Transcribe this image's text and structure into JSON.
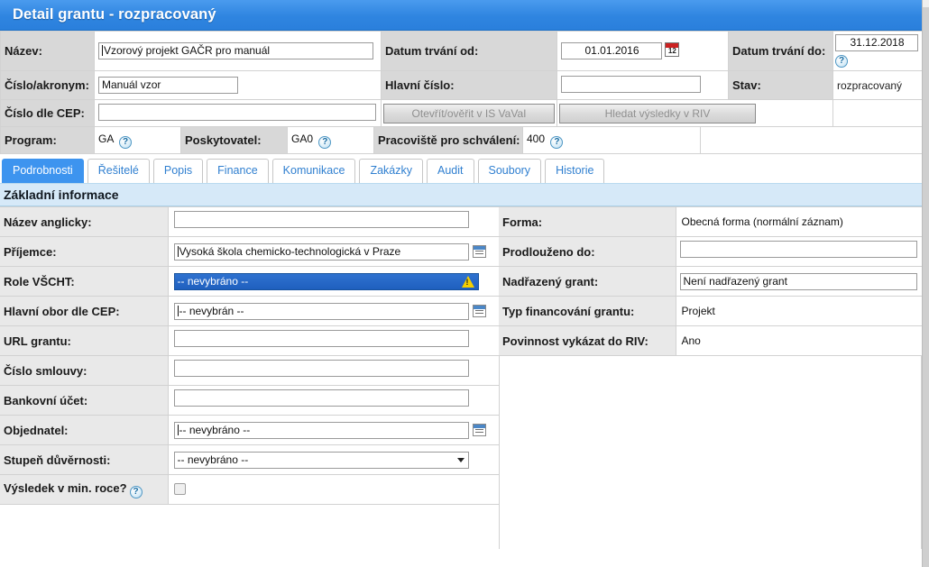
{
  "window": {
    "title": "Detail grantu - rozpracovaný",
    "accent_color": "#2f85e0",
    "band_color": "#d6e9f8"
  },
  "header": {
    "rows": [
      {
        "label_1": "Název:",
        "value_1": "Vzorový projekt GAČR pro manuál",
        "label_2": "Datum trvání od:",
        "value_2": "01.01.2016",
        "icon_2": "calendar-icon",
        "label_3": "Datum trvání do:",
        "value_3": "31.12.2018",
        "icon_3": "help-icon"
      },
      {
        "label_1": "Číslo/akronym:",
        "value_1": "Manuál vzor",
        "label_2": "Hlavní číslo:",
        "value_2": "",
        "label_3": "Stav:",
        "value_3": "rozpracovaný"
      }
    ],
    "cep_label": "Číslo dle CEP:",
    "cep_value": "",
    "button_isvavai": "Otevřít/ověřit v IS VaVaI",
    "button_riv": "Hledat výsledky v RIV",
    "program_label": "Program:",
    "program_value": "GA",
    "provider_label": "Poskytovatel:",
    "provider_value": "GA0",
    "workplace_label": "Pracoviště pro schválení:",
    "workplace_value": "400",
    "help_symbol": "?"
  },
  "tabs": [
    {
      "label": "Podrobnosti",
      "active": true
    },
    {
      "label": "Řešitelé",
      "active": false
    },
    {
      "label": "Popis",
      "active": false
    },
    {
      "label": "Finance",
      "active": false
    },
    {
      "label": "Komunikace",
      "active": false
    },
    {
      "label": "Zakázky",
      "active": false
    },
    {
      "label": "Audit",
      "active": false
    },
    {
      "label": "Soubory",
      "active": false
    },
    {
      "label": "Historie",
      "active": false
    }
  ],
  "section": {
    "title": "Základní informace"
  },
  "form_left": [
    {
      "label": "Název anglicky:",
      "value": "",
      "kind": "input"
    },
    {
      "label": "Příjemce:",
      "value": "Vysoká škola chemicko-technologická v Praze",
      "kind": "input-lookup"
    },
    {
      "label": "Role VŠCHT:",
      "value": "-- nevybráno --",
      "kind": "highlighted-select"
    },
    {
      "label": "Hlavní obor dle CEP:",
      "value": "-- nevybrán --",
      "kind": "input-lookup"
    },
    {
      "label": "URL grantu:",
      "value": "",
      "kind": "input"
    },
    {
      "label": "Číslo smlouvy:",
      "value": "",
      "kind": "input"
    },
    {
      "label": "Bankovní účet:",
      "value": "",
      "kind": "input"
    },
    {
      "label": "Objednatel:",
      "value": "-- nevybráno --",
      "kind": "input-lookup"
    },
    {
      "label": "Stupeň důvěrnosti:",
      "value": "-- nevybráno --",
      "kind": "dropdown"
    },
    {
      "label": "Výsledek v min. roce?",
      "value": "",
      "kind": "checkbox",
      "help": "?"
    }
  ],
  "form_right": [
    {
      "label": "Forma:",
      "value": "Obecná forma (normální záznam)",
      "kind": "text"
    },
    {
      "label": "Prodlouženo do:",
      "value": "",
      "kind": "input"
    },
    {
      "label": "Nadřazený grant:",
      "value": "Není nadřazený grant",
      "kind": "input"
    },
    {
      "label": "Typ financování grantu:",
      "value": "Projekt",
      "kind": "text"
    },
    {
      "label": "Povinnost vykázat do RIV:",
      "value": "Ano",
      "kind": "text"
    }
  ]
}
